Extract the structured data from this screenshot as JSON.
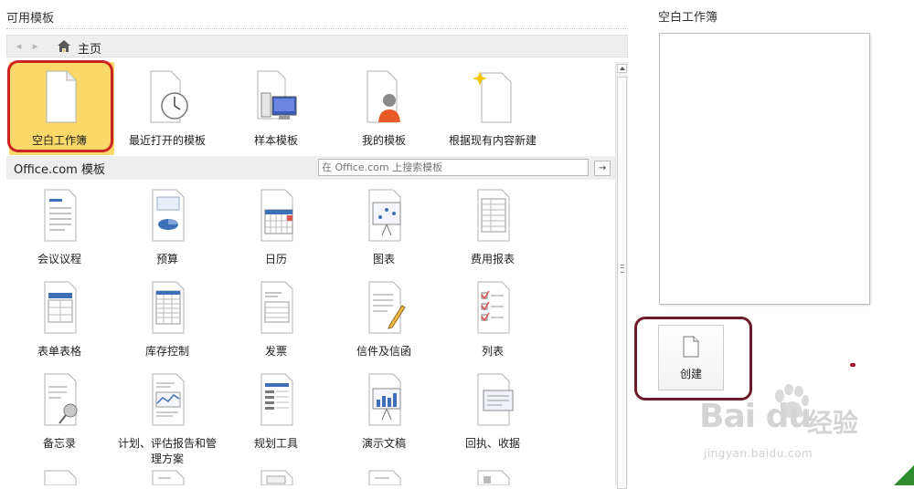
{
  "left_panel": {
    "title": "可用模板",
    "nav": {
      "back": "◂",
      "forward": "▸",
      "home": "主页"
    },
    "top_tiles": [
      {
        "label": "空白工作簿",
        "icon": "blank-document-icon",
        "selected": true
      },
      {
        "label": "最近打开的模板",
        "icon": "clock-document-icon"
      },
      {
        "label": "样本模板",
        "icon": "computer-document-icon"
      },
      {
        "label": "我的模板",
        "icon": "person-document-icon"
      },
      {
        "label": "根据现有内容新建",
        "icon": "sparkle-document-icon"
      }
    ],
    "office": {
      "label": "Office.com 模板",
      "search_placeholder": "在 Office.com 上搜索模板",
      "search_button": "→"
    },
    "office_tiles": [
      {
        "label": "会议议程",
        "icon": "agenda-document-icon"
      },
      {
        "label": "预算",
        "icon": "budget-document-icon"
      },
      {
        "label": "日历",
        "icon": "calendar-document-icon"
      },
      {
        "label": "图表",
        "icon": "chart-easel-icon"
      },
      {
        "label": "费用报表",
        "icon": "expense-report-icon"
      },
      {
        "label": "表单表格",
        "icon": "form-document-icon"
      },
      {
        "label": "库存控制",
        "icon": "inventory-document-icon"
      },
      {
        "label": "发票",
        "icon": "invoice-document-icon"
      },
      {
        "label": "信件及信函",
        "icon": "letter-pencil-icon"
      },
      {
        "label": "列表",
        "icon": "checklist-document-icon"
      },
      {
        "label": "备忘录",
        "icon": "memo-pin-icon"
      },
      {
        "label": "计划、评估报告和管",
        "label2": "理方案",
        "icon": "plan-chart-document-icon"
      },
      {
        "label": "规划工具",
        "icon": "planner-document-icon"
      },
      {
        "label": "演示文稿",
        "icon": "presentation-easel-icon"
      },
      {
        "label": "回执、收据",
        "icon": "receipt-document-icon"
      }
    ]
  },
  "right_panel": {
    "title": "空白工作簿",
    "create_label": "创建"
  },
  "watermark": {
    "brand": "Bai du",
    "cn": "经验",
    "url": "jingyan.baidu.com"
  },
  "colors": {
    "selected": "#fbd86a",
    "annotation_red": "#cc2222",
    "annotation_dark": "#6e1a2a",
    "corner_green": "#2e8b2e"
  }
}
